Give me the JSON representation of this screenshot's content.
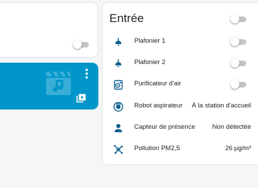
{
  "colors": {
    "accent": "#0096c9",
    "icon": "#0f5f8f",
    "toggle_off": "#c4c4c4"
  },
  "top_card": {
    "toggle_state": "off"
  },
  "media_card": {
    "icons": {
      "art": "video-music-icon",
      "menu": "more-vertical-icon",
      "browse": "play-box-multiple-icon"
    }
  },
  "entree": {
    "title": "Entrée",
    "toggle_state": "off",
    "rows": [
      {
        "label": "Plafonier 1",
        "icon": "ceiling-light-icon",
        "toggle_state": "off"
      },
      {
        "label": "Plafonier 2",
        "icon": "ceiling-light-icon",
        "toggle_state": "off"
      },
      {
        "label": "Purificateur d'air",
        "icon": "air-purifier-icon",
        "toggle_state": "off"
      },
      {
        "label": "Robot aspirateur",
        "icon": "robot-vacuum-icon",
        "state": "À la station d'accueil"
      },
      {
        "label": "Capteur de présence",
        "icon": "account-icon",
        "state": "Non détectée"
      },
      {
        "label": "Pollution PM2,5",
        "icon": "molecule-icon",
        "state": "26 µg/m³"
      }
    ]
  }
}
